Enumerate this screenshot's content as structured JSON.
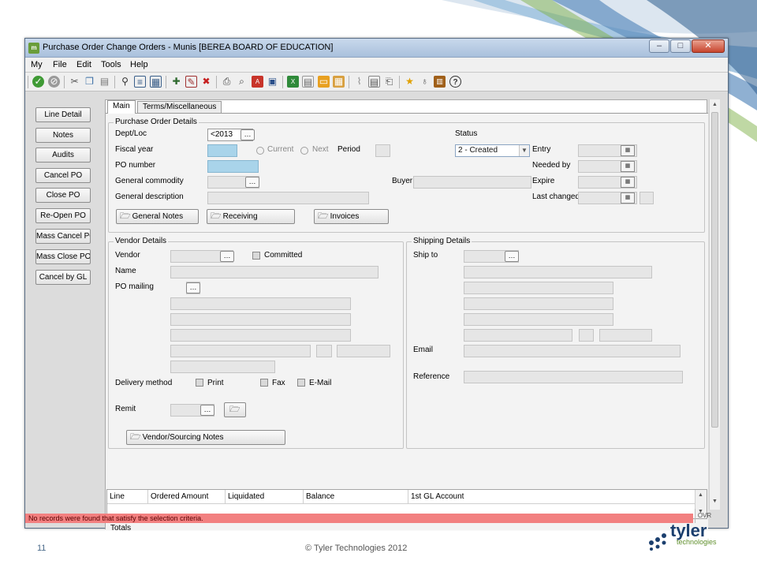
{
  "window": {
    "title": "Purchase Order Change Orders - Munis [BEREA BOARD OF EDUCATION]",
    "app_icon": "m"
  },
  "menu": [
    "My",
    "File",
    "Edit",
    "Tools",
    "Help"
  ],
  "toolbar_icons": [
    "accept-icon",
    "cancel-icon",
    "cut-icon",
    "copy-icon",
    "paste-icon",
    "search-icon",
    "browse-icon",
    "list-icon",
    "add-icon",
    "update-icon",
    "delete-icon",
    "print-icon",
    "preview-icon",
    "pdf-icon",
    "save-icon",
    "excel-icon",
    "word-icon",
    "output-icon",
    "attach-icon",
    "clip-icon",
    "notes-icon",
    "scan-icon",
    "favorite-icon",
    "tip-icon",
    "book-icon",
    "help-icon"
  ],
  "sidebar_buttons": [
    "Line Detail",
    "Notes",
    "Audits",
    "Cancel PO",
    "Close PO",
    "Re-Open PO",
    "Mass Cancel PO",
    "Mass Close PO",
    "Cancel by GL"
  ],
  "tabs": [
    "Main",
    "Terms/Miscellaneous"
  ],
  "po_details": {
    "title": "Purchase Order Details",
    "dept_loc_label": "Dept/Loc",
    "dept_loc_value": "<2013",
    "fiscal_year_label": "Fiscal year",
    "current_label": "Current",
    "next_label": "Next",
    "period_label": "Period",
    "po_number_label": "PO number",
    "general_commodity_label": "General commodity",
    "general_description_label": "General description",
    "buyer_label": "Buyer",
    "status_label": "Status",
    "status_value": "2 - Created",
    "entry_label": "Entry",
    "needed_by_label": "Needed by",
    "expire_label": "Expire",
    "last_changed_label": "Last changed",
    "general_notes_button": "General Notes",
    "receiving_button": "Receiving",
    "invoices_button": "Invoices"
  },
  "vendor": {
    "title": "Vendor Details",
    "vendor_label": "Vendor",
    "committed_label": "Committed",
    "name_label": "Name",
    "po_mailing_label": "PO mailing",
    "delivery_method_label": "Delivery method",
    "print_label": "Print",
    "fax_label": "Fax",
    "email_label": "E-Mail",
    "remit_label": "Remit",
    "sourcing_notes_button": "Vendor/Sourcing Notes"
  },
  "shipping": {
    "title": "Shipping Details",
    "ship_to_label": "Ship to",
    "email_label": "Email",
    "reference_label": "Reference"
  },
  "grid": {
    "columns": [
      "Line",
      "Ordered Amount",
      "Liquidated",
      "Balance",
      "1st GL Account"
    ]
  },
  "totals_label": "Totals",
  "status_message": "No records were found that satisfy the selection criteria.",
  "ovr": "OVR",
  "footer": {
    "page_number": "11",
    "copyright": "© Tyler Technologies 2012",
    "logo_word": "tyler",
    "logo_sub": "technologies"
  },
  "colors": {
    "status_bar": "#f28080",
    "highlight_field": "#a9d4ea",
    "logo_navy": "#1b3f6e",
    "logo_green": "#5f8f2c"
  }
}
